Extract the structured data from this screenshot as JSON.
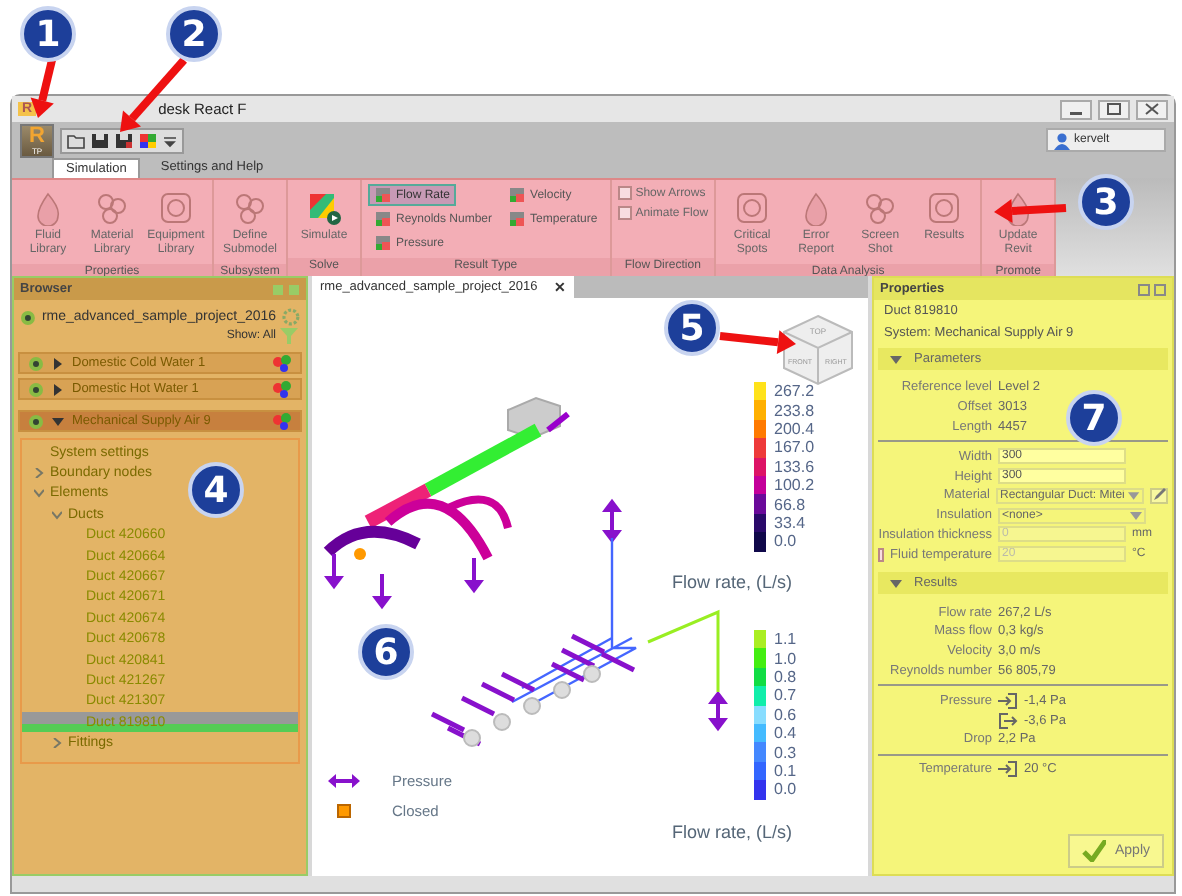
{
  "callouts": [
    {
      "number": "1"
    },
    {
      "number": "2"
    },
    {
      "number": "3"
    },
    {
      "number": "4"
    },
    {
      "number": "5"
    },
    {
      "number": "6"
    },
    {
      "number": "7"
    }
  ],
  "window": {
    "icon": "R",
    "title": "desk React F"
  },
  "quick_access": {
    "app_letter": "R",
    "app_label": "TP",
    "user": "kervelt"
  },
  "tabs": [
    {
      "label": "Simulation",
      "selected": true
    },
    {
      "label": "Settings and Help",
      "selected": false
    }
  ],
  "ribbon": [
    {
      "name": "Properties",
      "items": [
        {
          "kind": "large",
          "label": "Fluid Library"
        },
        {
          "kind": "large",
          "label": "Material Library"
        },
        {
          "kind": "large",
          "label": "Equipment Library"
        }
      ]
    },
    {
      "name": "Subsystem",
      "items": [
        {
          "kind": "large",
          "label": "Define Submodel"
        }
      ]
    },
    {
      "name": "Solve",
      "items": [
        {
          "kind": "large",
          "label": "Simulate"
        }
      ]
    },
    {
      "name": "Result Type",
      "items": [
        {
          "kind": "small",
          "label": "Flow Rate",
          "selected": true
        },
        {
          "kind": "small",
          "label": "Reynolds Number",
          "selected": false
        },
        {
          "kind": "small",
          "label": "Pressure",
          "selected": false
        },
        {
          "kind": "small",
          "label": "Velocity",
          "selected": false
        },
        {
          "kind": "small",
          "label": "Temperature",
          "selected": false
        }
      ]
    },
    {
      "name": "Flow Direction",
      "items": [
        {
          "kind": "check",
          "label": "Show Arrows",
          "checked": false
        },
        {
          "kind": "check",
          "label": "Animate Flow",
          "checked": false
        }
      ]
    },
    {
      "name": "Data Analysis",
      "items": [
        {
          "kind": "large",
          "label": "Critical Spots"
        },
        {
          "kind": "large",
          "label": "Error Report"
        },
        {
          "kind": "large",
          "label": "Screen Shot"
        },
        {
          "kind": "large",
          "label": "Results"
        }
      ]
    },
    {
      "name": "Promote",
      "items": [
        {
          "kind": "large",
          "label": "Update Revit"
        }
      ]
    }
  ],
  "browser": {
    "title": "Browser",
    "project": "rme_advanced_sample_project_2016",
    "filter": "Show: All",
    "systems": [
      {
        "name": "Domestic Cold Water 1",
        "expanded": false,
        "selected": false
      },
      {
        "name": "Domestic Hot Water 1",
        "expanded": false,
        "selected": false
      },
      {
        "name": "Mechanical Supply Air 9",
        "expanded": true,
        "selected": true
      }
    ],
    "tree": [
      {
        "label": "System settings",
        "selected": false
      },
      {
        "label": "Boundary nodes",
        "expanded": false,
        "selected": false
      },
      {
        "label": "Elements",
        "expanded": true,
        "selected": false,
        "children": [
          {
            "label": "Ducts",
            "expanded": true,
            "selected": false,
            "children": [
              {
                "label": "Duct 420660",
                "selected": false
              },
              {
                "label": "Duct 420664",
                "selected": false
              },
              {
                "label": "Duct 420667",
                "selected": false
              },
              {
                "label": "Duct 420671",
                "selected": false
              },
              {
                "label": "Duct 420674",
                "selected": false
              },
              {
                "label": "Duct 420678",
                "selected": false
              },
              {
                "label": "Duct 420841",
                "selected": false
              },
              {
                "label": "Duct 421267",
                "selected": false
              },
              {
                "label": "Duct 421307",
                "selected": false
              },
              {
                "label": "Duct 819810",
                "selected": true
              }
            ]
          },
          {
            "label": "Fittings",
            "expanded": false,
            "selected": false
          }
        ]
      }
    ]
  },
  "viewport": {
    "tab": "rme_advanced_sample_project_2016",
    "tab_close": "✕",
    "view_cube": [
      "TOP",
      "FRONT",
      "RIGHT"
    ],
    "scales": [
      {
        "title": "Flow rate, (L/s)",
        "steps": [
          {
            "label": "267.2",
            "color": "#ffe21a"
          },
          {
            "label": "233.8",
            "color": "#ffb000"
          },
          {
            "label": "200.4",
            "color": "#ff7a00"
          },
          {
            "label": "167.0",
            "color": "#ee3a3a"
          },
          {
            "label": "133.6",
            "color": "#dd1466"
          },
          {
            "label": "100.2",
            "color": "#c4009a"
          },
          {
            "label": "66.8",
            "color": "#6a0a9a"
          },
          {
            "label": "33.4",
            "color": "#2a0a6a"
          },
          {
            "label": "0.0",
            "color": "#10084a"
          }
        ]
      },
      {
        "title": "Flow rate, (L/s)",
        "steps": [
          {
            "label": "1.1",
            "color": "#aaee22"
          },
          {
            "label": "1.0",
            "color": "#44ee11"
          },
          {
            "label": "0.8",
            "color": "#11dd44"
          },
          {
            "label": "0.7",
            "color": "#11eeaa"
          },
          {
            "label": "0.6",
            "color": "#88ddff"
          },
          {
            "label": "0.4",
            "color": "#44bbff"
          },
          {
            "label": "0.3",
            "color": "#4488ff"
          },
          {
            "label": "0.1",
            "color": "#3366ff"
          },
          {
            "label": "0.0",
            "color": "#3333ee"
          }
        ]
      }
    ],
    "legend": [
      {
        "kind": "pressure",
        "label": "Pressure"
      },
      {
        "kind": "closed",
        "label": "Closed"
      }
    ]
  },
  "properties": {
    "title": "Properties",
    "element": "Duct 819810",
    "system": "System: Mechanical Supply Air 9",
    "sections": [
      {
        "title": "Parameters",
        "expanded": true,
        "groups": [
          [
            {
              "kind": "info",
              "label": "Reference level",
              "value": "Level 2"
            },
            {
              "kind": "info",
              "label": "Offset",
              "value": "3013"
            },
            {
              "kind": "info",
              "label": "Length",
              "value": "4457"
            }
          ],
          [
            {
              "kind": "input",
              "label": "Width",
              "value": "300",
              "disabled": false
            },
            {
              "kind": "input",
              "label": "Height",
              "value": "300",
              "disabled": false
            },
            {
              "kind": "select",
              "label": "Material",
              "value": "Rectangular Duct: Mitei",
              "edit": true
            },
            {
              "kind": "select",
              "label": "Insulation",
              "value": "<none>",
              "edit": false
            },
            {
              "kind": "input",
              "label": "Insulation thickness",
              "value": "0",
              "unit": "mm",
              "disabled": true
            },
            {
              "kind": "check-input",
              "label": "Fluid temperature",
              "checked": false,
              "value": "20",
              "unit": "°C",
              "disabled": true
            }
          ]
        ]
      },
      {
        "title": "Results",
        "expanded": true,
        "groups": [
          [
            {
              "kind": "info",
              "label": "Flow rate",
              "value": "267,2 L/s"
            },
            {
              "kind": "info",
              "label": "Mass flow",
              "value": "0,3 kg/s"
            },
            {
              "kind": "info",
              "label": "Velocity",
              "value": "3,0 m/s"
            },
            {
              "kind": "info",
              "label": "Reynolds number",
              "value": "56 805,79"
            }
          ],
          [
            {
              "kind": "port-in",
              "label": "Pressure",
              "value": "-1,4 Pa"
            },
            {
              "kind": "port-out",
              "value": "-3,6 Pa"
            },
            {
              "kind": "info",
              "label": "Drop",
              "value": "2,2 Pa"
            }
          ],
          [
            {
              "kind": "port-in",
              "label": "Temperature",
              "value": "20 °C"
            }
          ]
        ]
      }
    ],
    "apply": "Apply"
  }
}
